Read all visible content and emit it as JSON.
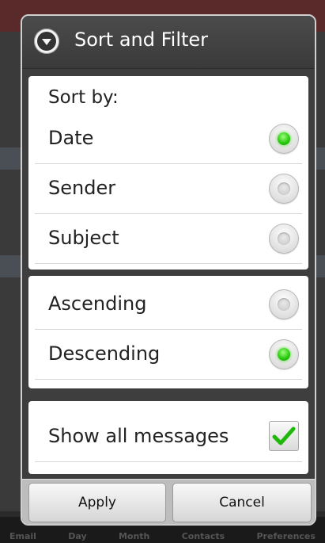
{
  "background": {
    "tabs": [
      "Email",
      "Day",
      "Month",
      "Contacts",
      "Preferences"
    ]
  },
  "dialog": {
    "title": "Sort and Filter",
    "sort_by_label": "Sort by:",
    "sort_options": [
      {
        "label": "Date",
        "selected": true
      },
      {
        "label": "Sender",
        "selected": false
      },
      {
        "label": "Subject",
        "selected": false
      }
    ],
    "order_options": [
      {
        "label": "Ascending",
        "selected": false
      },
      {
        "label": "Descending",
        "selected": true
      }
    ],
    "show_all": {
      "label": "Show all messages",
      "checked": true
    },
    "buttons": {
      "apply": "Apply",
      "cancel": "Cancel"
    }
  },
  "colors": {
    "radio_selected": "#26c60a",
    "checkmark": "#1fb80a"
  }
}
